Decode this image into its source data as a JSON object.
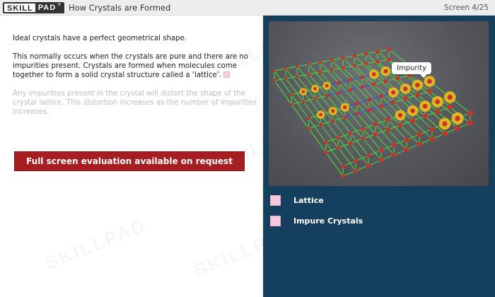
{
  "header": {
    "logo_left": "SKILL",
    "logo_right": "PAD",
    "logo_mark": "®",
    "title": "How Crystals are Formed",
    "screen_counter": "Screen 4/25"
  },
  "content": {
    "paragraph1": "Ideal crystals have a perfect geometrical shape.",
    "paragraph2": "This normally occurs when the crystals are pure and there are no impurities present. Crystals are formed when molecules come together to form a solid crystal structure called a ‘lattice’.",
    "paragraph3": "Any impurities present in the crystal will distort the shape of the crystal lattice. This distortion increases as the number of impurities increases."
  },
  "banner": {
    "label": "Full screen evaluation available on request",
    "color": "#a41e22"
  },
  "watermark": {
    "text": "SKILLPAD"
  },
  "image": {
    "callout": "Impurity"
  },
  "panel_menu": {
    "items": [
      {
        "label": "Lattice"
      },
      {
        "label": "Impure Crystals"
      }
    ]
  },
  "colors": {
    "panel_bg": "#14405e",
    "marker_pink": "#f6c8dd",
    "atom_red": "#c9322a",
    "atom_gold": "#e8b820",
    "bond_green": "#4ecb3a",
    "bond_blue": "#3b4fd8"
  }
}
